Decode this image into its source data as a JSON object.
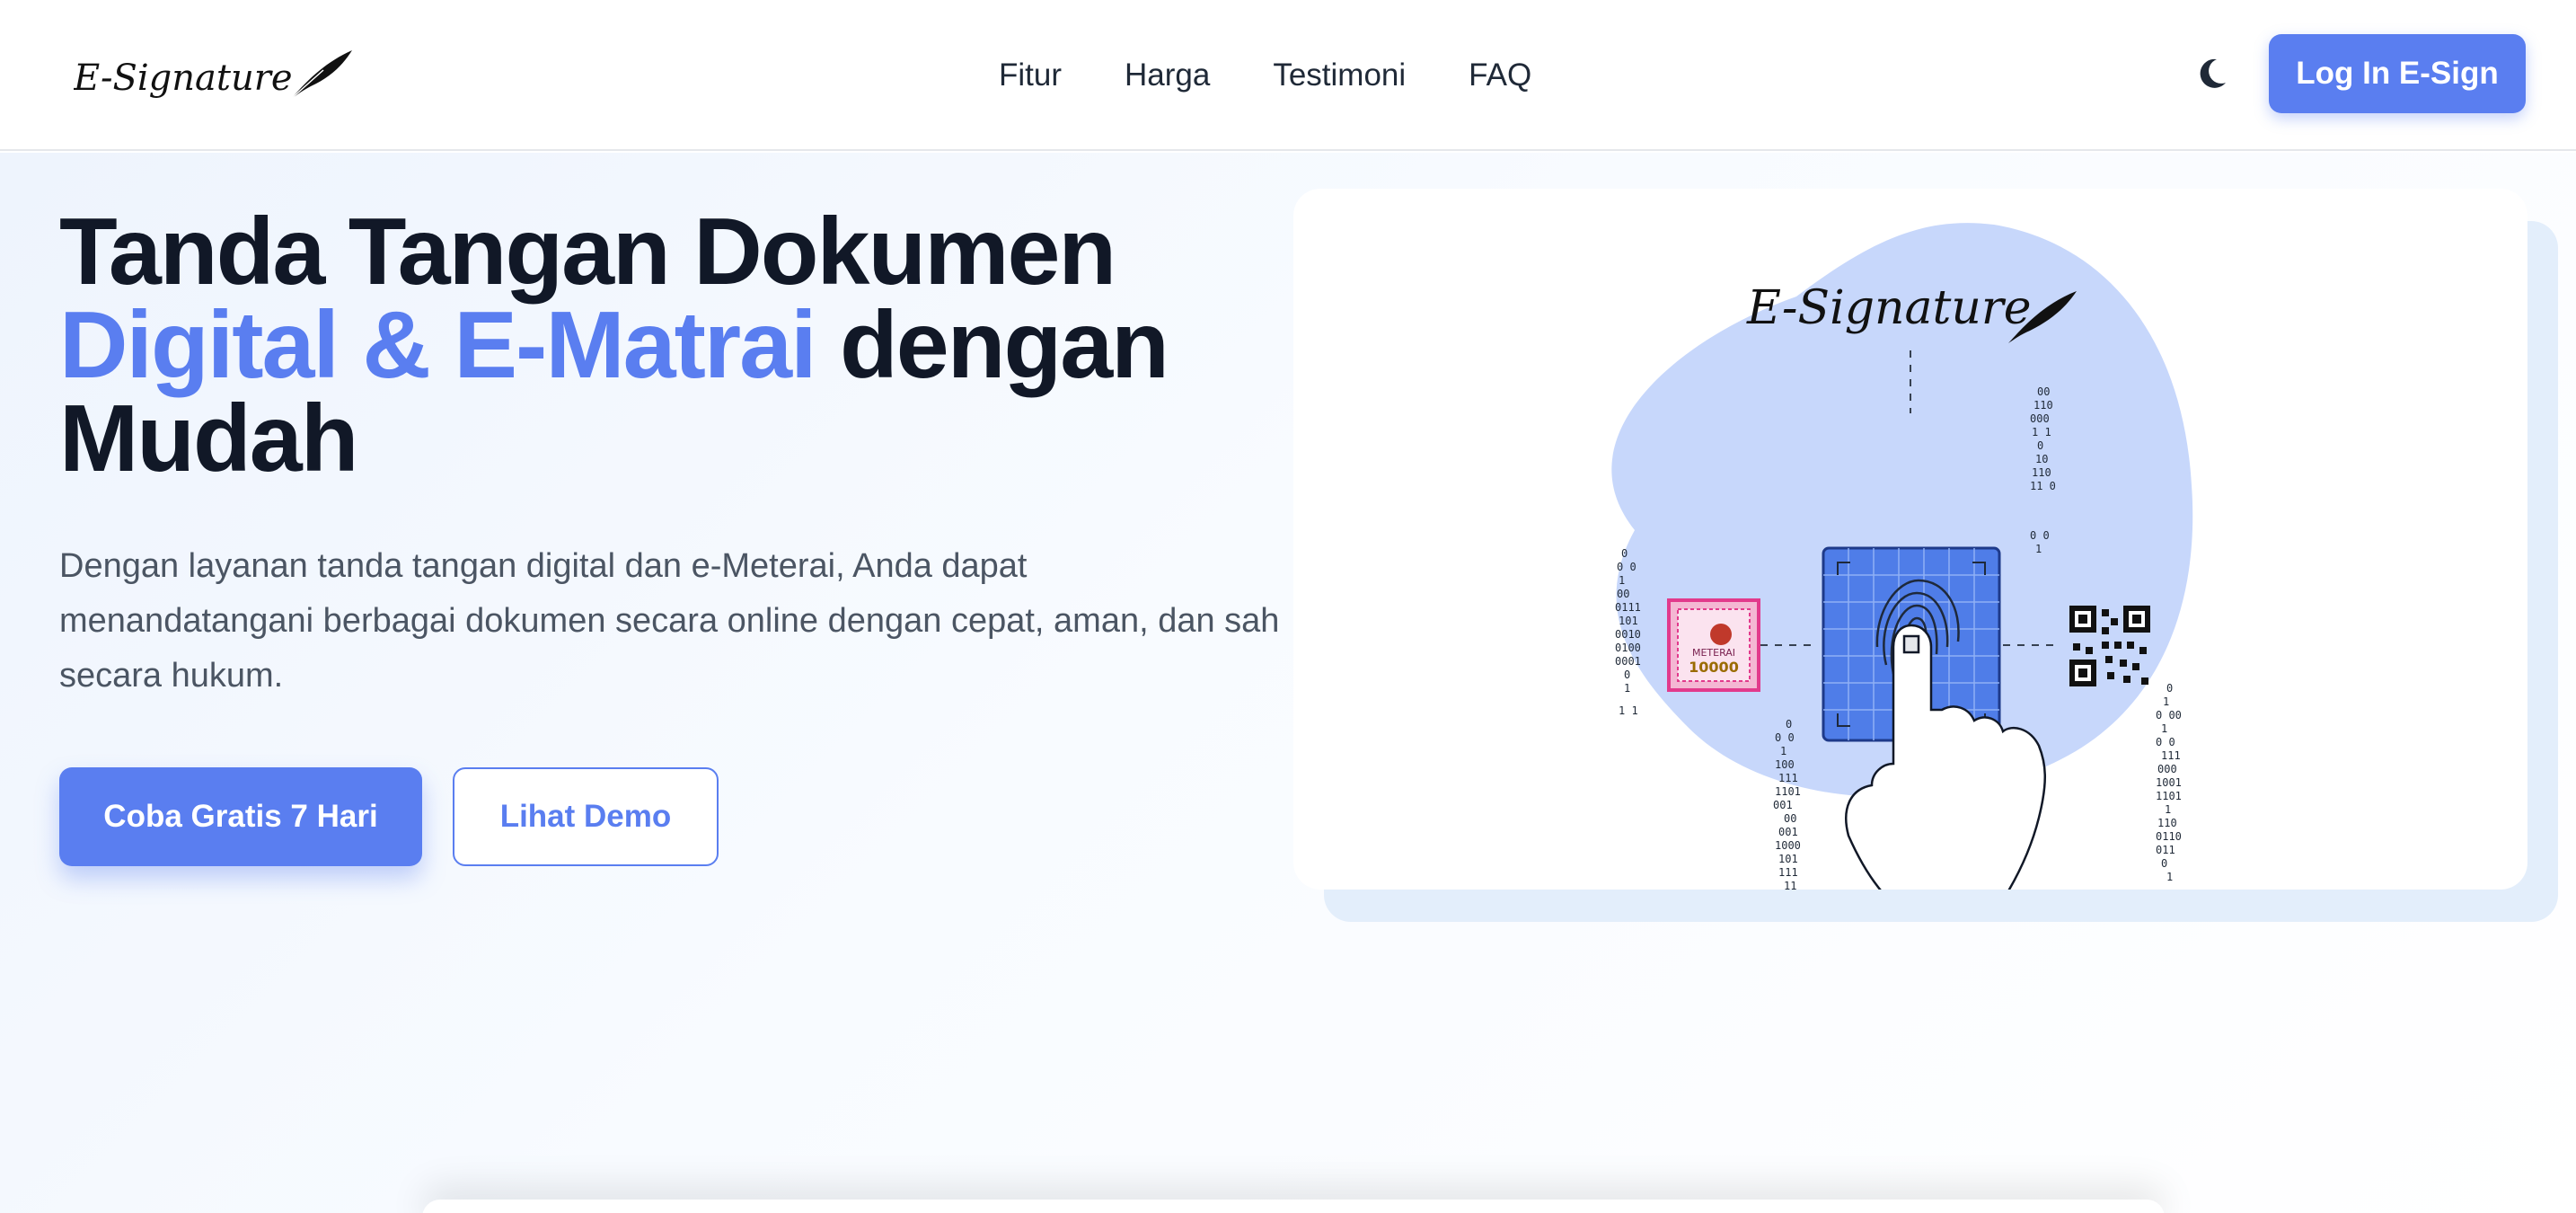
{
  "brand": {
    "name": "E-Signature",
    "accent": "#5a7ef0"
  },
  "nav": {
    "items": [
      "Fitur",
      "Harga",
      "Testimoni",
      "FAQ"
    ],
    "theme_toggle_icon": "moon-icon",
    "login_label": "Log In E-Sign"
  },
  "hero": {
    "headline_line1": "Tanda Tangan Dokumen",
    "headline_accent": "Digital & E-Matrai",
    "headline_rest": " dengan",
    "headline_line3": "Mudah",
    "subtext": "Dengan layanan tanda tangan digital dan e-Meterai, Anda dapat menandatangani berbagai dokumen secara online dengan cepat, aman, dan sah secara hukum.",
    "primary_cta": "Coba Gratis 7 Hari",
    "secondary_cta": "Lihat Demo"
  },
  "illustration": {
    "logo_text": "E-Signature",
    "stamp_label": "METERAI",
    "stamp_value": "10000",
    "icons": [
      "fingerprint-icon",
      "qr-code-icon",
      "meterai-stamp-icon",
      "hand-icon",
      "feather-icon"
    ]
  }
}
